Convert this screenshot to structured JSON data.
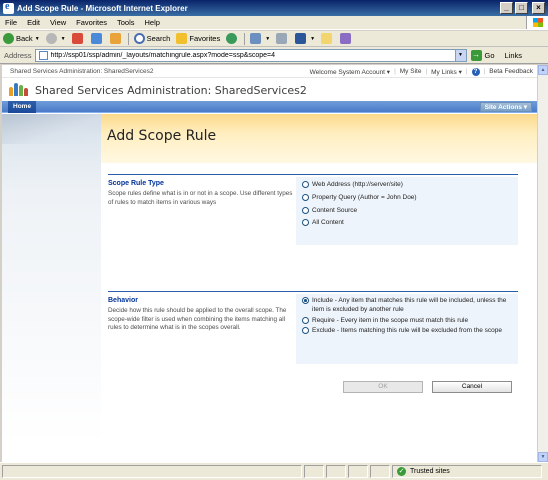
{
  "window": {
    "title": "Add Scope Rule - Microsoft Internet Explorer",
    "min_label": "_",
    "max_label": "□",
    "close_label": "×"
  },
  "menu": [
    "File",
    "Edit",
    "View",
    "Favorites",
    "Tools",
    "Help"
  ],
  "menu_underline": [
    "F",
    "E",
    "V",
    "a",
    "T",
    "H"
  ],
  "toolbar": {
    "back_label": "Back",
    "search_label": "Search",
    "favorites_label": "Favorites"
  },
  "address": {
    "label": "Address",
    "url": "http://ssp01/ssp/admin/_layouts/matchingrule.aspx?mode=ssp&scope=4",
    "go_label": "Go",
    "links_label": "Links"
  },
  "sharepoint": {
    "site_breadcrumb": "Shared Services Administration: SharedServices2",
    "welcome": "Welcome System Account ▾",
    "my_site": "My Site",
    "my_links": "My Links ▾",
    "beta_feedback": "Beta Feedback",
    "title": "Shared Services Administration: SharedServices2",
    "home_tab": "Home",
    "site_actions": "Site Actions ▾"
  },
  "page": {
    "heading": "Add Scope Rule",
    "scope_rule_type": {
      "header": "Scope Rule Type",
      "description": "Scope rules define what is in or not in a scope. Use different types of rules to match items in various ways",
      "options": [
        {
          "label": "Web Address (http://server/site)",
          "selected": false
        },
        {
          "label": "Property Query (Author = John Doe)",
          "selected": false
        },
        {
          "label": "Content Source",
          "selected": false
        },
        {
          "label": "All Content",
          "selected": false
        }
      ]
    },
    "behavior": {
      "header": "Behavior",
      "description": "Decide how this rule should be applied to the overall scope. The scope-wide filter is used when combining the items matching all rules to determine what is in the scopes overall.",
      "options": [
        {
          "label": "Include - Any item that matches this rule will be included, unless the item is excluded by another rule",
          "selected": true
        },
        {
          "label": "Require - Every item in the scope must match this rule",
          "selected": false
        },
        {
          "label": "Exclude - Items matching this rule will be excluded from the scope",
          "selected": false
        }
      ]
    },
    "ok_label": "OK",
    "cancel_label": "Cancel"
  },
  "status": {
    "zone_label": "Trusted sites"
  },
  "colors": {
    "title_bar": "#0a246a",
    "sp_nav": "#4a7ac9",
    "header_band": "#fbd98b",
    "section_header": "#003399"
  }
}
